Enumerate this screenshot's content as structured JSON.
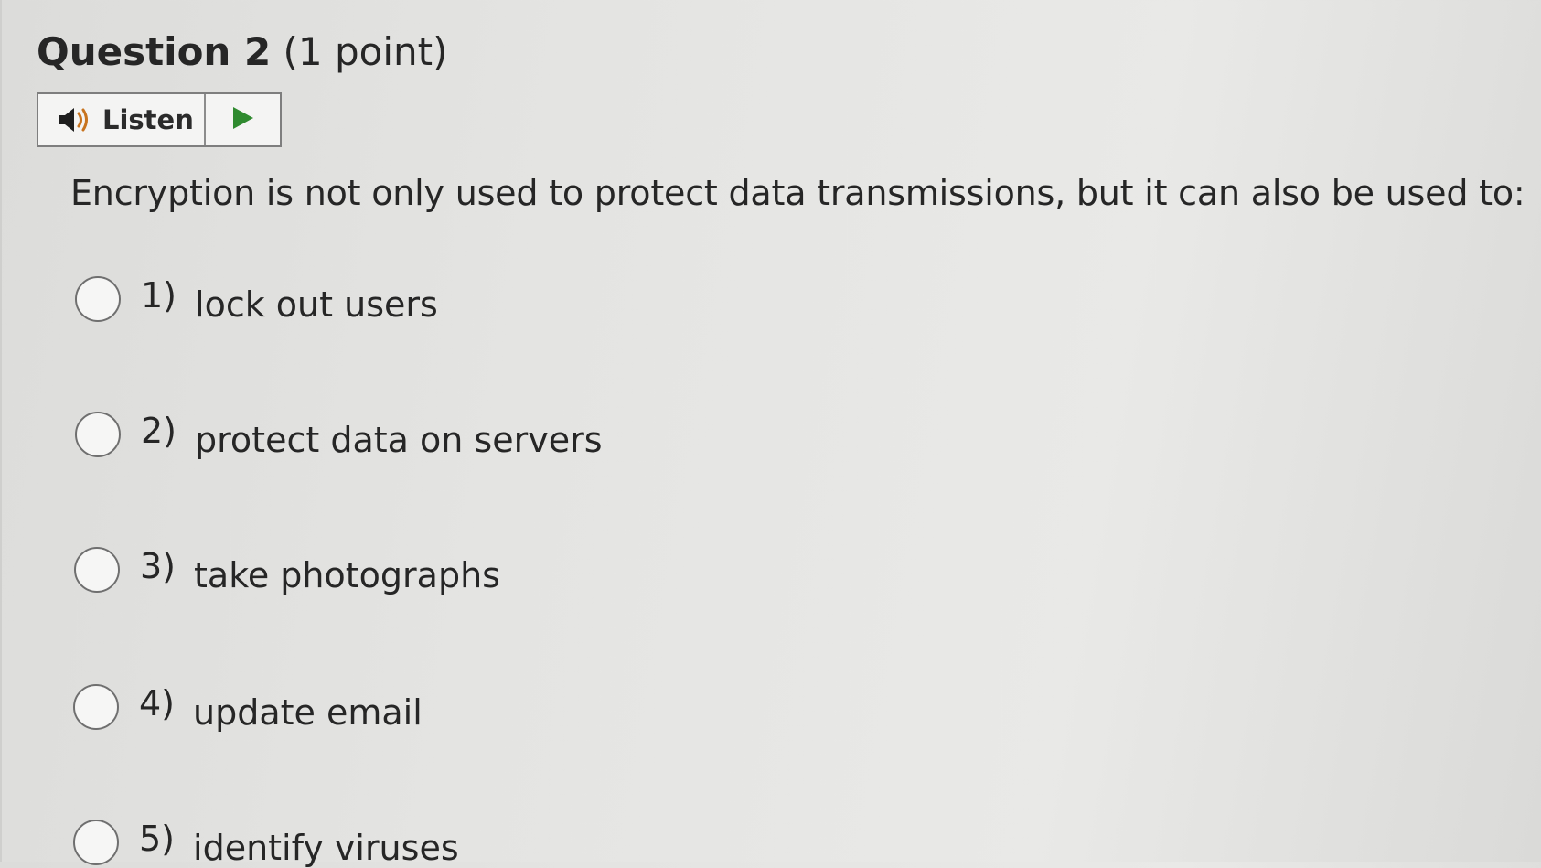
{
  "question": {
    "label": "Question 2",
    "points": "(1 point)",
    "text": "Encryption is not only used to protect data transmissions, but it can also be used to:"
  },
  "listen": {
    "label": "Listen",
    "speaker_icon": "speaker-icon",
    "play_icon": "play-icon",
    "play_color": "#2f8a2f"
  },
  "options": [
    {
      "number": "1)",
      "text": "lock out users"
    },
    {
      "number": "2)",
      "text": "protect data on servers"
    },
    {
      "number": "3)",
      "text": "take photographs"
    },
    {
      "number": "4)",
      "text": "update email"
    },
    {
      "number": "5)",
      "text": "identify viruses"
    }
  ]
}
